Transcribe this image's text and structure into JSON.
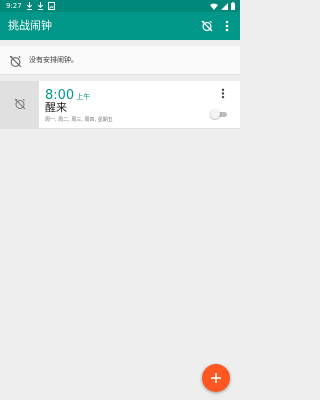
{
  "status_bar": {
    "time": "9:27",
    "notification_icons": [
      "download-icon",
      "download-icon",
      "image-icon"
    ],
    "system_icons": [
      "wifi-icon",
      "signal-icon",
      "battery-icon"
    ]
  },
  "app_bar": {
    "title": "挑战闹钟",
    "actions": [
      "alarm-off-icon",
      "more-vert-icon"
    ]
  },
  "banner": {
    "icon": "alarm-off-icon",
    "text": "没有安排闹钟。"
  },
  "alarms": [
    {
      "time": "8:00",
      "ampm": "上午",
      "label": "醒来",
      "days": "周一, 周二, 周三, 周四, 星期五",
      "enabled": false,
      "icon": "alarm-off-icon"
    }
  ],
  "fab": {
    "icon": "plus-icon"
  },
  "colors": {
    "primary": "#009688",
    "primary_dark": "#00897b",
    "accent": "#ff5722",
    "background": "#eeeeee"
  }
}
